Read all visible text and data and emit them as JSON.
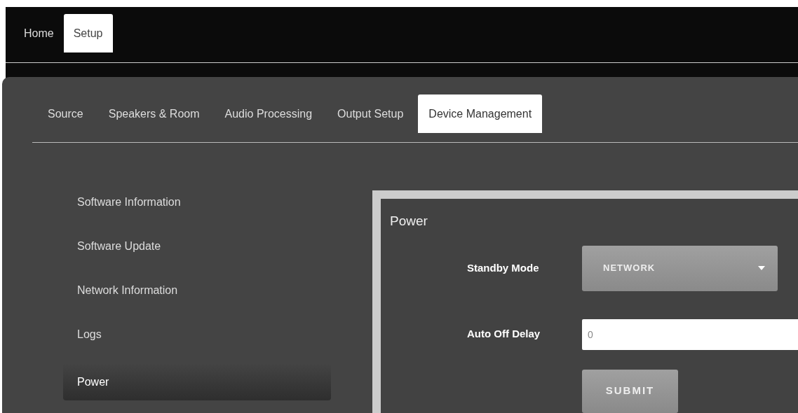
{
  "main_tabs": [
    {
      "label": "Home",
      "selected": false
    },
    {
      "label": "Setup",
      "selected": true
    }
  ],
  "setup_tabs": [
    {
      "label": "Source",
      "selected": false
    },
    {
      "label": "Speakers & Room",
      "selected": false
    },
    {
      "label": "Audio Processing",
      "selected": false
    },
    {
      "label": "Output Setup",
      "selected": false
    },
    {
      "label": "Device Management",
      "selected": true
    }
  ],
  "sidebar": {
    "items": [
      {
        "label": "Software Information",
        "selected": false
      },
      {
        "label": "Software Update",
        "selected": false
      },
      {
        "label": "Network Information",
        "selected": false
      },
      {
        "label": "Logs",
        "selected": false
      },
      {
        "label": "Power",
        "selected": true
      }
    ]
  },
  "panel": {
    "title": "Power",
    "standby_mode": {
      "label": "Standby Mode",
      "value": "NETWORK"
    },
    "auto_off_delay": {
      "label": "Auto Off Delay",
      "placeholder": "0"
    },
    "submit": "SUBMIT"
  }
}
